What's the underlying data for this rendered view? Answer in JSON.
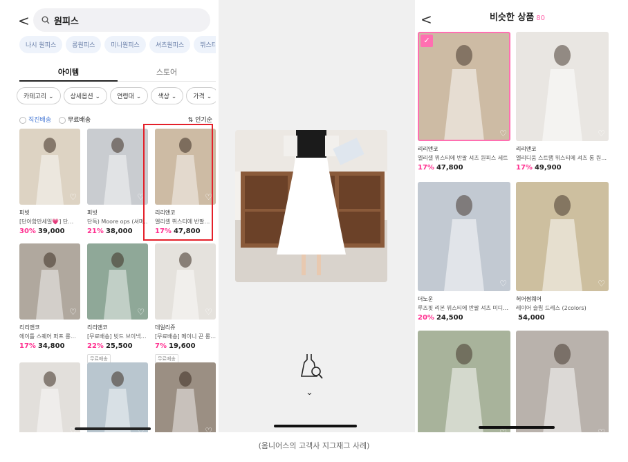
{
  "left": {
    "back_glyph": "<",
    "search_value": "원피스",
    "chips": [
      "나시 원피스",
      "롱원피스",
      "미니원피스",
      "셔츠원피스",
      "뷔스티에 원"
    ],
    "tabs": [
      "아이템",
      "스토어"
    ],
    "filters": [
      "카테고리",
      "상세옵션",
      "연령대",
      "색상",
      "가격"
    ],
    "opt1": "직진배송",
    "opt2": "무료배송",
    "sort": "인기순",
    "products": [
      {
        "shop": "퍼빗",
        "desc": "[단아함만세일💗] 단…",
        "disc": "30%",
        "price": "39,000",
        "tag": "",
        "img": "#ddd3c3"
      },
      {
        "shop": "퍼빗",
        "desc": "단독) Moore ops (셔머…",
        "disc": "21%",
        "price": "38,000",
        "tag": "",
        "img": "#c9ccd0"
      },
      {
        "shop": "리리앤코",
        "desc": "엘리셀 뷔스티에 반팔…",
        "disc": "17%",
        "price": "47,800",
        "tag": "",
        "img": "#cdbba4"
      },
      {
        "shop": "리리앤코",
        "desc": "에이틀 스퀘어 퍼프 롱…",
        "disc": "17%",
        "price": "34,800",
        "tag": "",
        "img": "#b0a89e"
      },
      {
        "shop": "리리앤코",
        "desc": "[무료배송] 빗드 브이넥…",
        "disc": "22%",
        "price": "25,500",
        "tag": "무료배송",
        "img": "#8fa898"
      },
      {
        "shop": "데일리쥬",
        "desc": "[무료배송] 메이니 끈 롱…",
        "disc": "7%",
        "price": "19,600",
        "tag": "무료배송",
        "img": "#e5e2dd"
      },
      {
        "shop": "",
        "desc": "",
        "disc": "",
        "price": "",
        "tag": "",
        "img": "#e2dfdb"
      },
      {
        "shop": "",
        "desc": "",
        "disc": "",
        "price": "",
        "tag": "",
        "img": "#b9c6cf"
      },
      {
        "shop": "",
        "desc": "",
        "disc": "",
        "price": "",
        "tag": "",
        "img": "#9b8f83"
      }
    ]
  },
  "middle": {
    "chevron": "⌄"
  },
  "right": {
    "back_glyph": "<",
    "title": "비슷한 상품",
    "count": "80",
    "products": [
      {
        "shop": "리리앤코",
        "desc": "엘리셀 뷔스티에 반팔 셔츠 원피스 세트",
        "disc": "17%",
        "price": "47,800",
        "img": "#cdbba4",
        "selected": true
      },
      {
        "shop": "리리앤코",
        "desc": "엘리디움 스트랩 뷔스티에 셔츠 롱 원…",
        "disc": "17%",
        "price": "49,900",
        "img": "#e9e6e2",
        "selected": false
      },
      {
        "shop": "더노운",
        "desc": "루즈핏 리본 뷔스티에 반팔 셔츠 미디…",
        "disc": "20%",
        "price": "24,500",
        "img": "#c2c9d2",
        "selected": false
      },
      {
        "shop": "허어썸웨어",
        "desc": "레이어 슬립 드레스 (2colors)",
        "disc": "",
        "price": "54,000",
        "img": "#cdbf9f",
        "selected": false
      },
      {
        "shop": "",
        "desc": "",
        "disc": "",
        "price": "",
        "img": "#a8b39b",
        "selected": false
      },
      {
        "shop": "",
        "desc": "",
        "disc": "",
        "price": "",
        "img": "#b9b2ac",
        "selected": false
      }
    ]
  },
  "caption": "(옴니어스의 고객사 지그재그 사례)",
  "colors": {
    "accent_pink": "#ff2e8f",
    "highlight_red": "#e4202a",
    "select_pink": "#ff6fb1"
  }
}
